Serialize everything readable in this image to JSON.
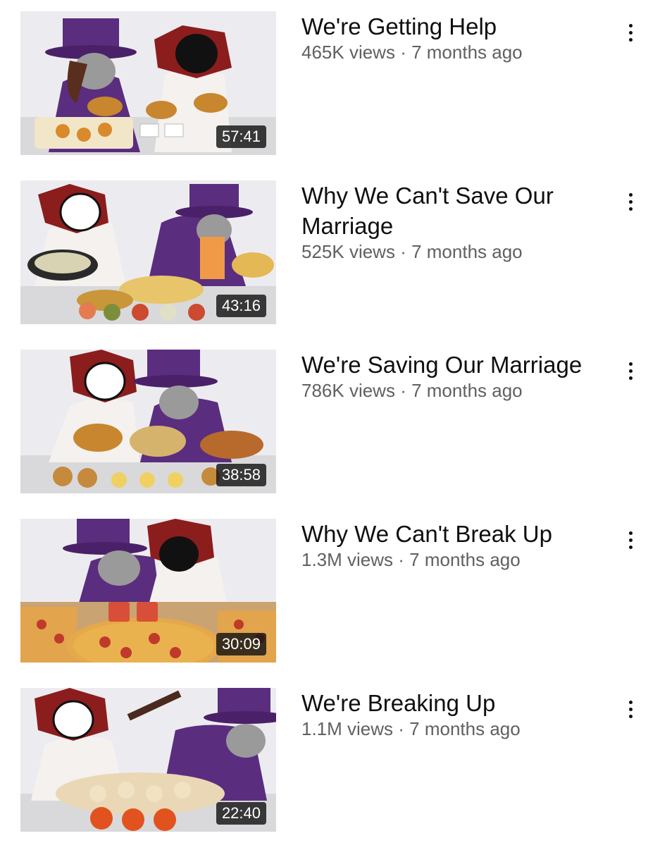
{
  "videos": [
    {
      "title": "We're Getting Help",
      "views": "465K views",
      "age": "7 months ago",
      "duration": "57:41"
    },
    {
      "title": "Why We Can't Save Our Marriage",
      "views": "525K views",
      "age": "7 months ago",
      "duration": "43:16"
    },
    {
      "title": "We're Saving Our Marriage",
      "views": "786K views",
      "age": "7 months ago",
      "duration": "38:58"
    },
    {
      "title": "Why We Can't Break Up",
      "views": "1.3M views",
      "age": "7 months ago",
      "duration": "30:09"
    },
    {
      "title": "We're Breaking Up",
      "views": "1.1M views",
      "age": "7 months ago",
      "duration": "22:40"
    }
  ],
  "menu_icon": "more-vert-icon",
  "colors": {
    "title": "#0f0f0f",
    "stats": "#606060",
    "duration_bg": "#141414",
    "hat_purple": "#5b2d7e"
  }
}
